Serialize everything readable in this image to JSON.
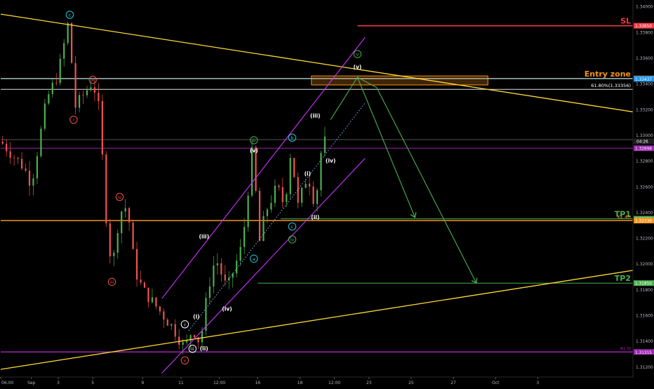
{
  "chart_data": {
    "type": "candlestick",
    "title": "",
    "ylim": [
      1.3112,
      1.3405
    ],
    "y_ticks": [
      "1.34000",
      "1.33800",
      "1.33600",
      "1.33400",
      "1.33200",
      "1.33000",
      "1.32800",
      "1.32600",
      "1.32400",
      "1.32200",
      "1.32000",
      "1.31800",
      "1.31600",
      "1.31400",
      "1.31200"
    ],
    "y_tick_values": [
      1.34,
      1.338,
      1.336,
      1.334,
      1.332,
      1.33,
      1.328,
      1.326,
      1.324,
      1.322,
      1.32,
      1.318,
      1.316,
      1.314,
      1.312
    ],
    "x_ticks": [
      "06:00",
      "Sep",
      "3",
      "5",
      "9",
      "11",
      "12:00",
      "16",
      "18",
      "12:00",
      "23",
      "25",
      "27",
      "Oct",
      "3"
    ],
    "x_tick_index": [
      0,
      8,
      15,
      24,
      37,
      47,
      57,
      67,
      78,
      87,
      96,
      107,
      118,
      129,
      140
    ],
    "x_count": 165,
    "candle_count": 85,
    "price_levels": [
      {
        "name": "SL",
        "label": "SL",
        "badge": "1.33850",
        "value": 1.3385,
        "color": "#f23645",
        "x_start_index": 93
      },
      {
        "name": "Entry zone",
        "label": "Entry zone",
        "badge": "1.33440",
        "value": 1.3344,
        "color": "#f7931a",
        "x_start_index": 0
      },
      {
        "name": "current-blue",
        "label": "",
        "badge": "1.33437",
        "value": 1.33437,
        "color": "#2196f3",
        "x_start_index": 0
      },
      {
        "name": "fib-618",
        "label": "61.80%(1.33356)",
        "badge": "",
        "value": 1.33356,
        "color": "#e0e0e0",
        "x_start_index": 0
      },
      {
        "name": "price-grey",
        "label": "",
        "badge": "",
        "value": 1.32965,
        "color": "#555555",
        "x_start_index": 0
      },
      {
        "name": "price-purple",
        "label": "",
        "badge": "1.32898",
        "value": 1.32898,
        "color": "#9c27b0",
        "x_start_index": 0
      },
      {
        "name": "TP1",
        "label": "TP1",
        "badge": "1.32350",
        "value": 1.3235,
        "color": "#4caf50",
        "x_start_index": 73
      },
      {
        "name": "KL 4H",
        "label": "KL 4H",
        "badge": "1.32336",
        "value": 1.32336,
        "color": "#f7931a",
        "x_start_index": 0
      },
      {
        "name": "TP2",
        "label": "TP2",
        "badge": "1.31850",
        "value": 1.3185,
        "color": "#4caf50",
        "x_start_index": 67
      },
      {
        "name": "KL D",
        "label": "KL D",
        "badge": "1.31315",
        "value": 1.31315,
        "color": "#9c27b0",
        "x_start_index": 0
      }
    ],
    "countdown": "04:26",
    "trendlines": [
      {
        "name": "upper-yellow",
        "color": "#fdd835",
        "points": [
          [
            0,
            1.3394
          ],
          [
            165,
            1.3318
          ]
        ]
      },
      {
        "name": "lower-yellow",
        "color": "#fdd835",
        "points": [
          [
            0,
            1.3118
          ],
          [
            165,
            1.3195
          ]
        ]
      }
    ],
    "channel": {
      "color": "#cc33ff",
      "upper": [
        [
          42,
          1.3173
        ],
        [
          95,
          1.3376
        ]
      ],
      "lower": [
        [
          42,
          1.3115
        ],
        [
          95,
          1.3282
        ]
      ],
      "mid": [
        [
          49,
          1.3148
        ],
        [
          95,
          1.3325
        ]
      ]
    },
    "entry_box": {
      "x_start_index": 81,
      "x_end_index": 127,
      "y_top": 1.3346,
      "y_bottom": 1.3339
    },
    "projections": [
      {
        "points": [
          [
            86,
            1.3312
          ],
          [
            93,
            1.3345
          ],
          [
            108,
            1.3236
          ]
        ],
        "color": "#4caf50"
      },
      {
        "points": [
          [
            93,
            1.3345
          ],
          [
            98,
            1.3337
          ],
          [
            124,
            1.3185
          ]
        ],
        "color": "#4caf50"
      }
    ],
    "waves": [
      {
        "label": "c",
        "x_index": 18,
        "value": 1.33935,
        "style": "circled",
        "color": "#26c6da"
      },
      {
        "label": "ii",
        "x_index": 24,
        "value": 1.3343,
        "style": "circled",
        "color": "#ef5350"
      },
      {
        "label": "i",
        "x_index": 19,
        "value": 1.3312,
        "style": "circled",
        "color": "#ef5350"
      },
      {
        "label": "iv",
        "x_index": 31,
        "value": 1.3252,
        "style": "circled",
        "color": "#ef5350"
      },
      {
        "label": "iii",
        "x_index": 29,
        "value": 1.3186,
        "style": "circled",
        "color": "#ef5350"
      },
      {
        "label": "v",
        "x_index": 48,
        "value": 1.3125,
        "style": "circled",
        "color": "#ef5350"
      },
      {
        "label": "i",
        "x_index": 48,
        "value": 1.3153,
        "style": "circled",
        "color": "#ffffff"
      },
      {
        "label": "ii",
        "x_index": 50,
        "value": 1.3134,
        "style": "circled",
        "color": "#ffffff"
      },
      {
        "label": "(i)",
        "x_index": 51,
        "value": 1.3159,
        "style": "paren",
        "color": "#ffffff"
      },
      {
        "label": "(ii)",
        "x_index": 53,
        "value": 1.3134,
        "style": "paren",
        "color": "#ffffff"
      },
      {
        "label": "(iii)",
        "x_index": 53,
        "value": 1.3221,
        "style": "paren",
        "color": "#ffffff"
      },
      {
        "label": "(iv)",
        "x_index": 59,
        "value": 1.3165,
        "style": "paren",
        "color": "#ffffff"
      },
      {
        "label": "a",
        "x_index": 66,
        "value": 1.3204,
        "style": "circled",
        "color": "#26c6da"
      },
      {
        "label": "iii",
        "x_index": 66,
        "value": 1.3296,
        "style": "circled",
        "color": "#4caf50"
      },
      {
        "label": "(v)",
        "x_index": 66,
        "value": 1.3288,
        "style": "paren",
        "color": "#ffffff"
      },
      {
        "label": "b",
        "x_index": 76,
        "value": 1.3298,
        "style": "circled",
        "color": "#26c6da"
      },
      {
        "label": "c",
        "x_index": 76,
        "value": 1.3229,
        "style": "circled",
        "color": "#26c6da"
      },
      {
        "label": "iv",
        "x_index": 76,
        "value": 1.3219,
        "style": "circled",
        "color": "#4caf50"
      },
      {
        "label": "(i)",
        "x_index": 80,
        "value": 1.327,
        "style": "paren",
        "color": "#ffffff"
      },
      {
        "label": "(ii)",
        "x_index": 82,
        "value": 1.3236,
        "style": "paren",
        "color": "#ffffff"
      },
      {
        "label": "(iii)",
        "x_index": 82,
        "value": 1.3315,
        "style": "paren",
        "color": "#ffffff"
      },
      {
        "label": "(iv)",
        "x_index": 86,
        "value": 1.328,
        "style": "paren",
        "color": "#ffffff"
      },
      {
        "label": "v",
        "x_index": 93,
        "value": 1.3363,
        "style": "circled",
        "color": "#4caf50"
      },
      {
        "label": "(v)",
        "x_index": 93,
        "value": 1.3353,
        "style": "paren",
        "color": "#ffffff"
      }
    ]
  }
}
